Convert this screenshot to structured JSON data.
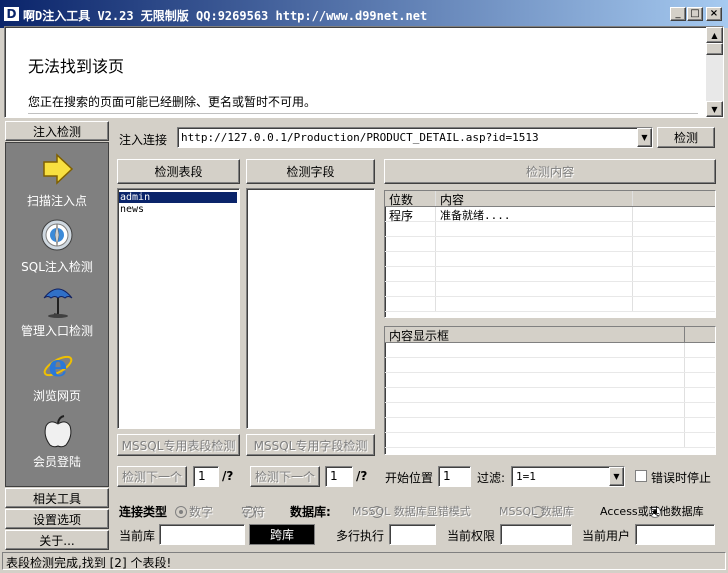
{
  "window": {
    "title": "啊D注入工具 V2.23 无限制版 QQ:9269563 http://www.d99net.net",
    "icon_letter": "D",
    "controls": {
      "minimize": "_",
      "maximize": "□",
      "close": "×"
    }
  },
  "browser": {
    "heading": "无法找到该页",
    "message": "您正在搜索的页面可能已经删除、更名或暂时不可用。"
  },
  "sidebar": {
    "top_tab": "注入检测",
    "items": [
      {
        "label": "扫描注入点",
        "icon": "arrow-icon"
      },
      {
        "label": "SQL注入检测",
        "icon": "compass-icon"
      },
      {
        "label": "管理入口检测",
        "icon": "umbrella-icon"
      },
      {
        "label": "浏览网页",
        "icon": "ie-icon"
      },
      {
        "label": "会员登陆",
        "icon": "apple-icon"
      }
    ],
    "bottom_tabs": [
      "相关工具",
      "设置选项",
      "关于..."
    ]
  },
  "url_bar": {
    "label": "注入连接",
    "value": "http://127.0.0.1/Production/PRODUCT_DETAIL.asp?id=1513",
    "button": "检测"
  },
  "tables_panel": {
    "button": "检测表段",
    "items": [
      "admin",
      "news"
    ],
    "selected_index": 0,
    "mssql_button": "MSSQL专用表段检测",
    "next_button": "检测下一个",
    "counter_value": "1",
    "counter_suffix": "/?"
  },
  "fields_panel": {
    "button": "检测字段",
    "items": [],
    "mssql_button": "MSSQL专用字段检测",
    "next_button": "检测下一个",
    "counter_value": "1",
    "counter_suffix": "/?"
  },
  "content_panel": {
    "button": "检测内容",
    "columns": [
      "位数",
      "内容"
    ],
    "rows": [
      {
        "pos": "程序",
        "content": "准备就绪...."
      }
    ],
    "display_header": "内容显示框"
  },
  "options": {
    "start_label": "开始位置",
    "start_value": "1",
    "filter_label": "过滤:",
    "filter_value": "1=1",
    "stop_on_error": "错误时停止"
  },
  "conn_type": {
    "label": "连接类型",
    "options": [
      "数字",
      "字符"
    ],
    "selected": 0
  },
  "database": {
    "label": "数据库:",
    "options": [
      "MSSQL 数据库显错模式",
      "MSSQL 数据库",
      "Access或其他数据库"
    ],
    "selected": 2
  },
  "info_row": {
    "current_db_label": "当前库",
    "cross_db_button": "跨库",
    "multi_exec_label": "多行执行",
    "privilege_label": "当前权限",
    "user_label": "当前用户"
  },
  "status": "表段检测完成,找到 [2] 个表段!"
}
